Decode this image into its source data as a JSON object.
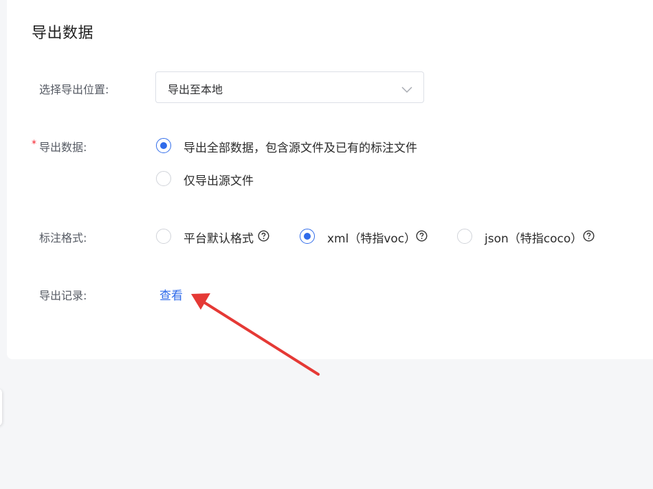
{
  "page": {
    "title": "导出数据"
  },
  "location": {
    "label": "选择导出位置:",
    "selected": "导出至本地",
    "chevron_icon": "chevron-down-icon"
  },
  "export_data": {
    "required_mark": "*",
    "label": "导出数据:",
    "options": [
      {
        "label": "导出全部数据，包含源文件及已有的标注文件",
        "checked": true
      },
      {
        "label": "仅导出源文件",
        "checked": false
      }
    ]
  },
  "annotation_format": {
    "label": "标注格式:",
    "options": [
      {
        "label": "平台默认格式",
        "checked": false,
        "help_icon": "question-circle-icon"
      },
      {
        "label": "xml（特指voc）",
        "checked": true,
        "help_icon": "question-circle-icon"
      },
      {
        "label": "json（特指coco）",
        "checked": false,
        "help_icon": "question-circle-icon"
      }
    ]
  },
  "export_record": {
    "label": "导出记录:",
    "link": "查看"
  },
  "colors": {
    "accent": "#2f6bea",
    "required": "#f5222d",
    "annotation_arrow": "#e53935"
  }
}
